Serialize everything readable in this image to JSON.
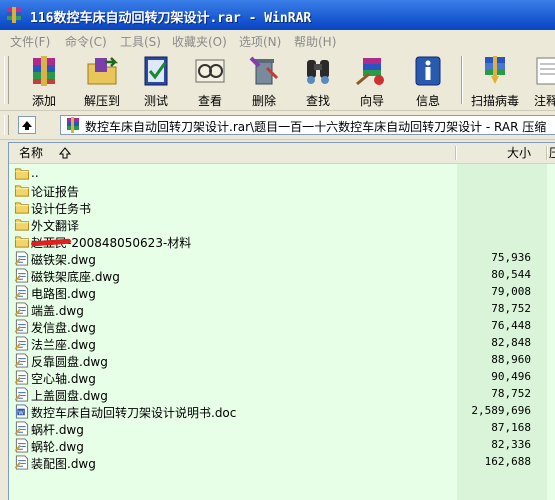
{
  "window": {
    "title": "116数控车床自动回转刀架设计.rar - WinRAR"
  },
  "menu": [
    "文件(F)",
    "命令(C)",
    "工具(S)",
    "收藏夹(O)",
    "选项(N)",
    "帮助(H)"
  ],
  "toolbar": [
    {
      "label": "添加",
      "icon": "add-archive-icon"
    },
    {
      "label": "解压到",
      "icon": "extract-to-icon"
    },
    {
      "label": "测试",
      "icon": "test-icon"
    },
    {
      "label": "查看",
      "icon": "view-icon"
    },
    {
      "label": "删除",
      "icon": "delete-icon"
    },
    {
      "label": "查找",
      "icon": "find-icon"
    },
    {
      "label": "向导",
      "icon": "wizard-icon"
    },
    {
      "label": "信息",
      "icon": "info-icon"
    },
    {
      "label": "扫描病毒",
      "icon": "scan-virus-icon"
    },
    {
      "label": "注释",
      "icon": "comment-icon"
    }
  ],
  "address": {
    "path": "数控车床自动回转刀架设计.rar\\题目一百一十六数控车床自动回转刀架设计 - RAR 压缩"
  },
  "columns": {
    "name": "名称",
    "size": "大小",
    "ratio": "压缩"
  },
  "files": [
    {
      "name": "..",
      "size": "",
      "type": "folder"
    },
    {
      "name": "论证报告",
      "size": "",
      "type": "folder"
    },
    {
      "name": "设计任务书",
      "size": "",
      "type": "folder"
    },
    {
      "name": "外文翻译",
      "size": "",
      "type": "folder"
    },
    {
      "name": "赵亚民-200848050623-材料",
      "size": "",
      "type": "folder"
    },
    {
      "name": "磁铁架.dwg",
      "size": "75,936",
      "type": "dwg"
    },
    {
      "name": "磁铁架底座.dwg",
      "size": "80,544",
      "type": "dwg"
    },
    {
      "name": "电路图.dwg",
      "size": "79,008",
      "type": "dwg"
    },
    {
      "name": "端盖.dwg",
      "size": "78,752",
      "type": "dwg"
    },
    {
      "name": "发信盘.dwg",
      "size": "76,448",
      "type": "dwg"
    },
    {
      "name": "法兰座.dwg",
      "size": "82,848",
      "type": "dwg"
    },
    {
      "name": "反靠圆盘.dwg",
      "size": "88,960",
      "type": "dwg"
    },
    {
      "name": "空心轴.dwg",
      "size": "90,496",
      "type": "dwg"
    },
    {
      "name": "上盖圆盘.dwg",
      "size": "78,752",
      "type": "dwg"
    },
    {
      "name": "数控车床自动回转刀架设计说明书.doc",
      "size": "2,589,696",
      "type": "doc"
    },
    {
      "name": "蜗杆.dwg",
      "size": "87,168",
      "type": "dwg"
    },
    {
      "name": "蜗轮.dwg",
      "size": "82,336",
      "type": "dwg"
    },
    {
      "name": "装配图.dwg",
      "size": "162,688",
      "type": "dwg"
    }
  ]
}
